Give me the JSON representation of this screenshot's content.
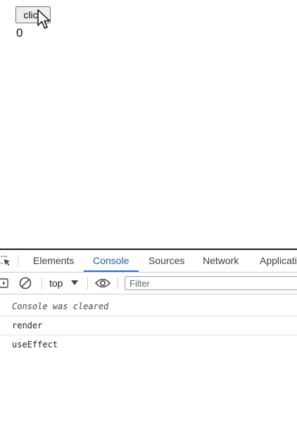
{
  "app": {
    "button_label": "click",
    "count": "0"
  },
  "devtools": {
    "tabs": [
      {
        "label": "Elements",
        "active": false
      },
      {
        "label": "Console",
        "active": true
      },
      {
        "label": "Sources",
        "active": false
      },
      {
        "label": "Network",
        "active": false
      },
      {
        "label": "Application",
        "active": false
      }
    ],
    "toolbar": {
      "context": "top",
      "filter_placeholder": "Filter"
    },
    "console_messages": [
      {
        "text": "Console was cleared",
        "kind": "system"
      },
      {
        "text": "render",
        "kind": "log"
      },
      {
        "text": "useEffect",
        "kind": "log"
      }
    ]
  },
  "colors": {
    "active_tab": "#1a73e8",
    "border": "#cbcdd1",
    "row_divider": "#e3e5e8"
  },
  "icons": {
    "cursor": "mouse-pointer-icon",
    "inspect": "inspect-element-icon",
    "sidebar": "sidebar-toggle-icon",
    "clear": "clear-console-icon",
    "context_arrow": "dropdown-arrow-icon",
    "live_expression": "eye-icon"
  }
}
